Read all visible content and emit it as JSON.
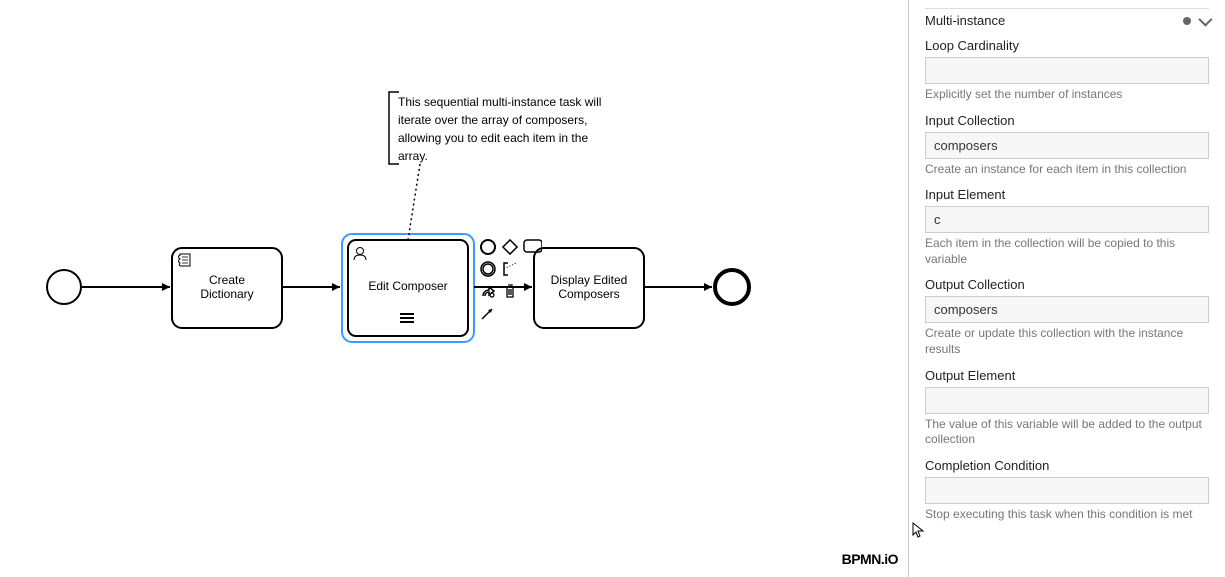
{
  "diagram": {
    "tasks": {
      "createDictionary": {
        "line1": "Create",
        "line2": "Dictionary"
      },
      "editComposer": {
        "label": "Edit Composer"
      },
      "displayComposers": {
        "line1": "Display Edited",
        "line2": "Composers"
      }
    },
    "annotation": {
      "line1": "This sequential multi-instance task will",
      "line2": "iterate over the array of composers,",
      "line3": "allowing you to edit each item in the",
      "line4": "array."
    },
    "logo": "BPMN.iO"
  },
  "panel": {
    "title": "Multi-instance",
    "loopCardinality": {
      "label": "Loop Cardinality",
      "value": "",
      "help": "Explicitly set the number of instances"
    },
    "inputCollection": {
      "label": "Input Collection",
      "value": "composers",
      "help": "Create an instance for each item in this collection"
    },
    "inputElement": {
      "label": "Input Element",
      "value": "c",
      "help": "Each item in the collection will be copied to this variable"
    },
    "outputCollection": {
      "label": "Output Collection",
      "value": "composers",
      "help": "Create or update this collection with the instance results"
    },
    "outputElement": {
      "label": "Output Element",
      "value": "",
      "help": "The value of this variable will be added to the output collection"
    },
    "completionCondition": {
      "label": "Completion Condition",
      "value": "",
      "help": "Stop executing this task when this condition is met"
    }
  }
}
